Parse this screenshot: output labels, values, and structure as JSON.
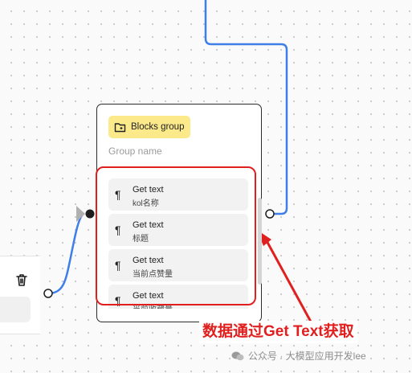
{
  "group": {
    "badge_label": "Blocks group",
    "name_placeholder": "Group name"
  },
  "blocks": [
    {
      "title": "Get text",
      "subtitle": "kol名称"
    },
    {
      "title": "Get text",
      "subtitle": "标题"
    },
    {
      "title": "Get text",
      "subtitle": "当前点赞量"
    },
    {
      "title": "Get text",
      "subtitle": "当前收藏量"
    }
  ],
  "block_glyph": "¶",
  "annotation": "数据通过Get Text获取",
  "watermark": "公众号 · 大模型应用开发lee",
  "icons": [
    "trash-icon",
    "folder-icon",
    "pilcrow-icon",
    "wechat-icon"
  ],
  "colors": {
    "wire": "#3f7ee8",
    "highlight": "#e0201e",
    "badge": "#fbe98a"
  }
}
